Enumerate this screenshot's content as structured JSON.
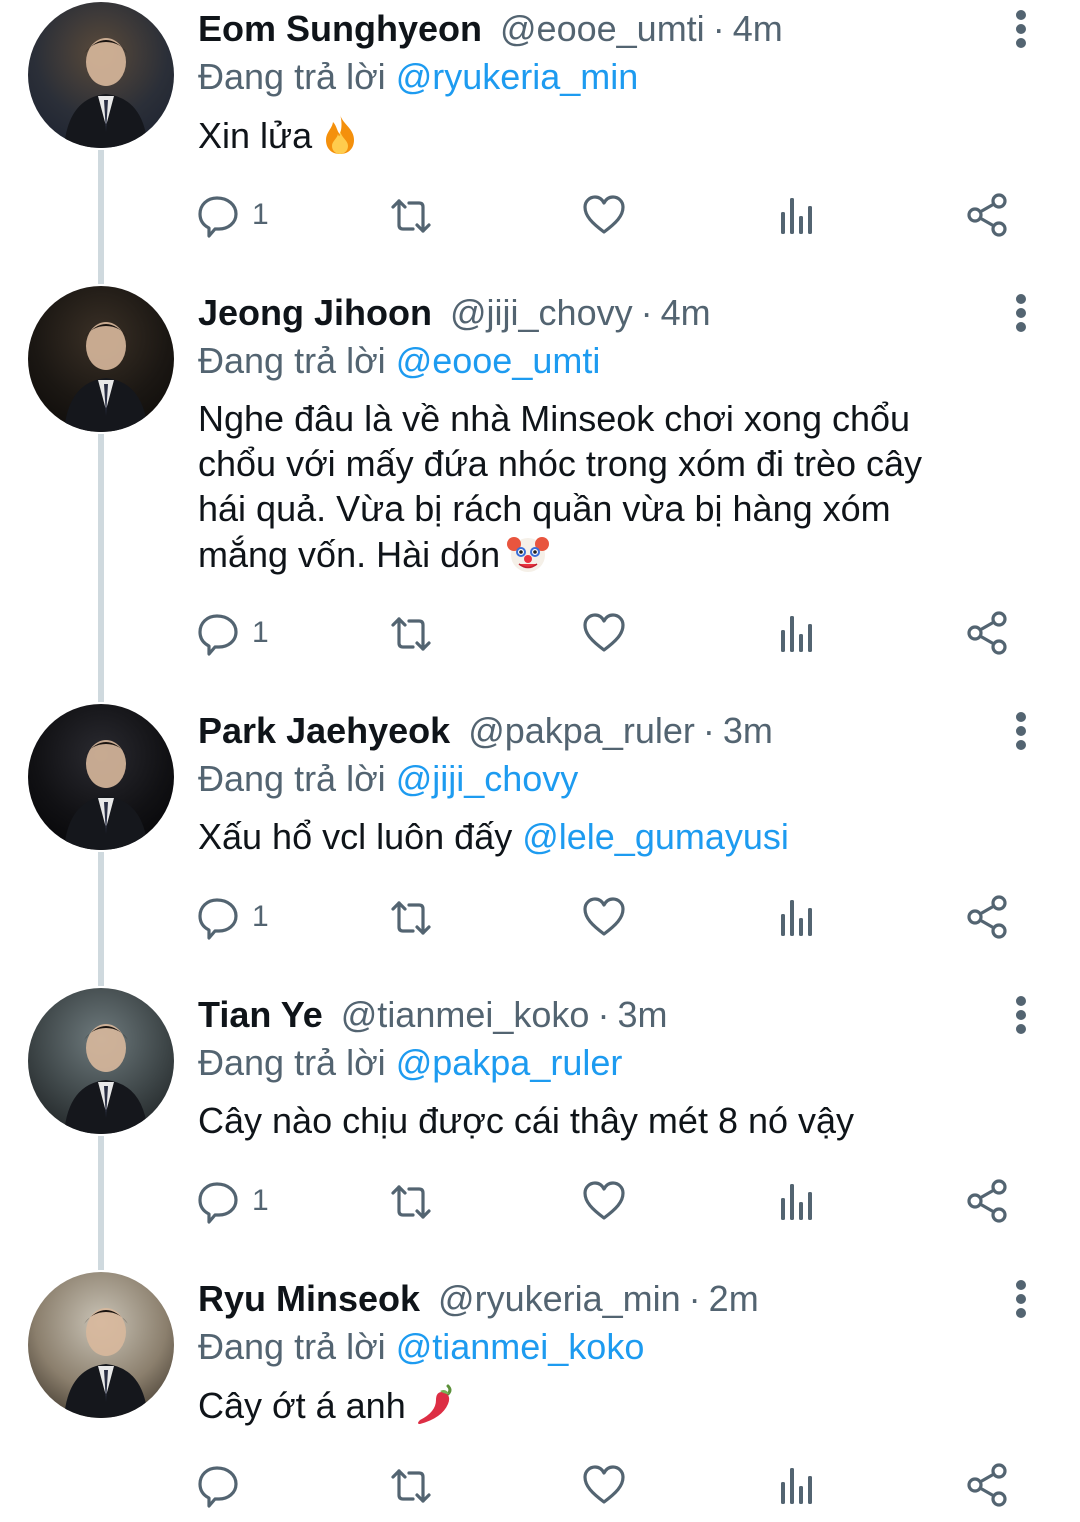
{
  "tweets": [
    {
      "display_name": "Eom Sunghyeon",
      "handle": "@eooe_umti",
      "separator": "·",
      "time": "4m",
      "reply_prefix": "Đang trả lời",
      "reply_to": "@ryukeria_min",
      "text_lines": [
        "Xin lửa"
      ],
      "text_mention": "",
      "trailing_emoji": "fire-emoji",
      "reply_count": "1",
      "avatar_icon": "avatar-photo"
    },
    {
      "display_name": "Jeong Jihoon",
      "handle": "@jiji_chovy",
      "separator": "·",
      "time": "4m",
      "reply_prefix": "Đang trả lời",
      "reply_to": "@eooe_umti",
      "text_lines": [
        "Nghe đâu là về nhà Minseok chơi xong chổu",
        "chổu với mấy đứa nhóc trong xóm đi trèo cây",
        "hái quả. Vừa bị rách quần vừa bị hàng xóm",
        "mắng vốn. Hài dón"
      ],
      "text_mention": "",
      "trailing_emoji": "clown-face-emoji",
      "reply_count": "1",
      "avatar_icon": "avatar-photo"
    },
    {
      "display_name": "Park Jaehyeok",
      "handle": "@pakpa_ruler",
      "separator": "·",
      "time": "3m",
      "reply_prefix": "Đang trả lời",
      "reply_to": "@jiji_chovy",
      "text_lines": [
        "Xấu hổ vcl luôn đấy"
      ],
      "text_mention": "@lele_gumayusi",
      "trailing_emoji": "",
      "reply_count": "1",
      "avatar_icon": "avatar-photo"
    },
    {
      "display_name": "Tian Ye",
      "handle": "@tianmei_koko",
      "separator": "·",
      "time": "3m",
      "reply_prefix": "Đang trả lời",
      "reply_to": "@pakpa_ruler",
      "text_lines": [
        "Cây nào chịu được cái thây mét 8 nó vậy"
      ],
      "text_mention": "",
      "trailing_emoji": "",
      "reply_count": "1",
      "avatar_icon": "avatar-photo"
    },
    {
      "display_name": "Ryu Minseok",
      "handle": "@ryukeria_min",
      "separator": "·",
      "time": "2m",
      "reply_prefix": "Đang trả lời",
      "reply_to": "@tianmei_koko",
      "text_lines": [
        "Cây ớt á anh"
      ],
      "text_mention": "",
      "trailing_emoji": "hot-pepper-emoji",
      "reply_count": "",
      "avatar_icon": "avatar-photo"
    }
  ],
  "action_icons": [
    "reply-icon",
    "retweet-icon",
    "like-icon",
    "views-icon",
    "share-icon"
  ],
  "colors": {
    "background": "#ffffff",
    "primary_text": "#0f1419",
    "secondary_text": "#536471",
    "mention": "#1d9bf0",
    "thread_line": "#cfd9de"
  }
}
